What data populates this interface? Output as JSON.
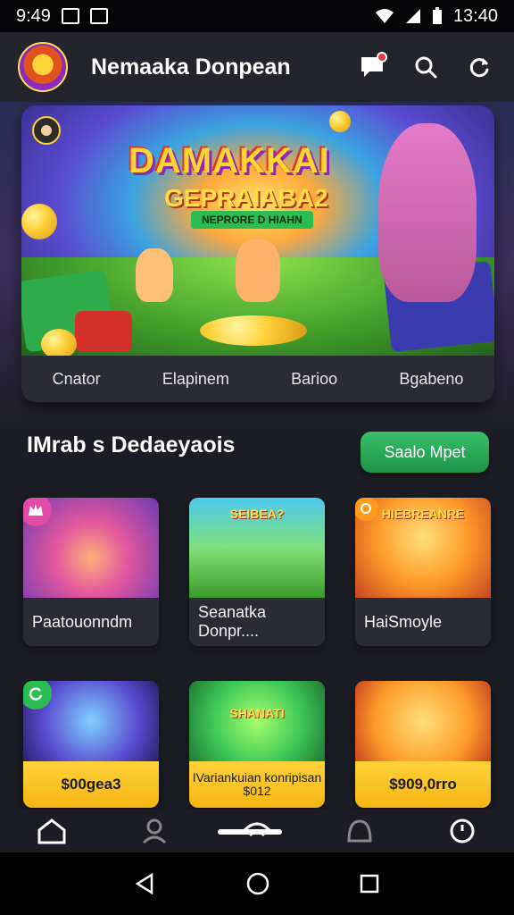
{
  "status_bar": {
    "time_left": "9:49",
    "time_right": "13:40"
  },
  "app": {
    "title": "Nemaaka Donpean"
  },
  "banner": {
    "title": "DAMAKKAI",
    "subtitle": "GEPRAIABA2",
    "ribbon": "NEPRORE D HIAHN",
    "tabs": [
      "Cnator",
      "Elapinem",
      "Barioo",
      "Bgabeno"
    ]
  },
  "section": {
    "title": "IMrab s Dedaeyaois",
    "button_label": "Saalo Mpet"
  },
  "cards_row1": [
    {
      "label": "Paatouonndm",
      "art_text": ""
    },
    {
      "label": "Seanatka Donpr....",
      "art_text": "SEIBEA?"
    },
    {
      "label": "HaiSmoyle",
      "art_text": "HIEBREANRE"
    }
  ],
  "cards_row2": [
    {
      "price": "$00gea3",
      "art_text": ""
    },
    {
      "price": "IVariankuian konripisan $012",
      "art_text": "SHANATI"
    },
    {
      "price": "$909,0rro",
      "art_text": ""
    }
  ],
  "colors": {
    "accent_green": "#2bbd52",
    "gold": "#ffd23a",
    "bg": "#1c1d24"
  },
  "icons": {
    "appbar": [
      "chat-bubble-icon",
      "search-icon",
      "refresh-icon"
    ],
    "bottom_nav": [
      "home-icon",
      "user-icon",
      "wifi-icon",
      "bell-icon",
      "clock-icon"
    ],
    "system_nav": [
      "back-icon",
      "home-circle-icon",
      "recents-icon"
    ]
  }
}
